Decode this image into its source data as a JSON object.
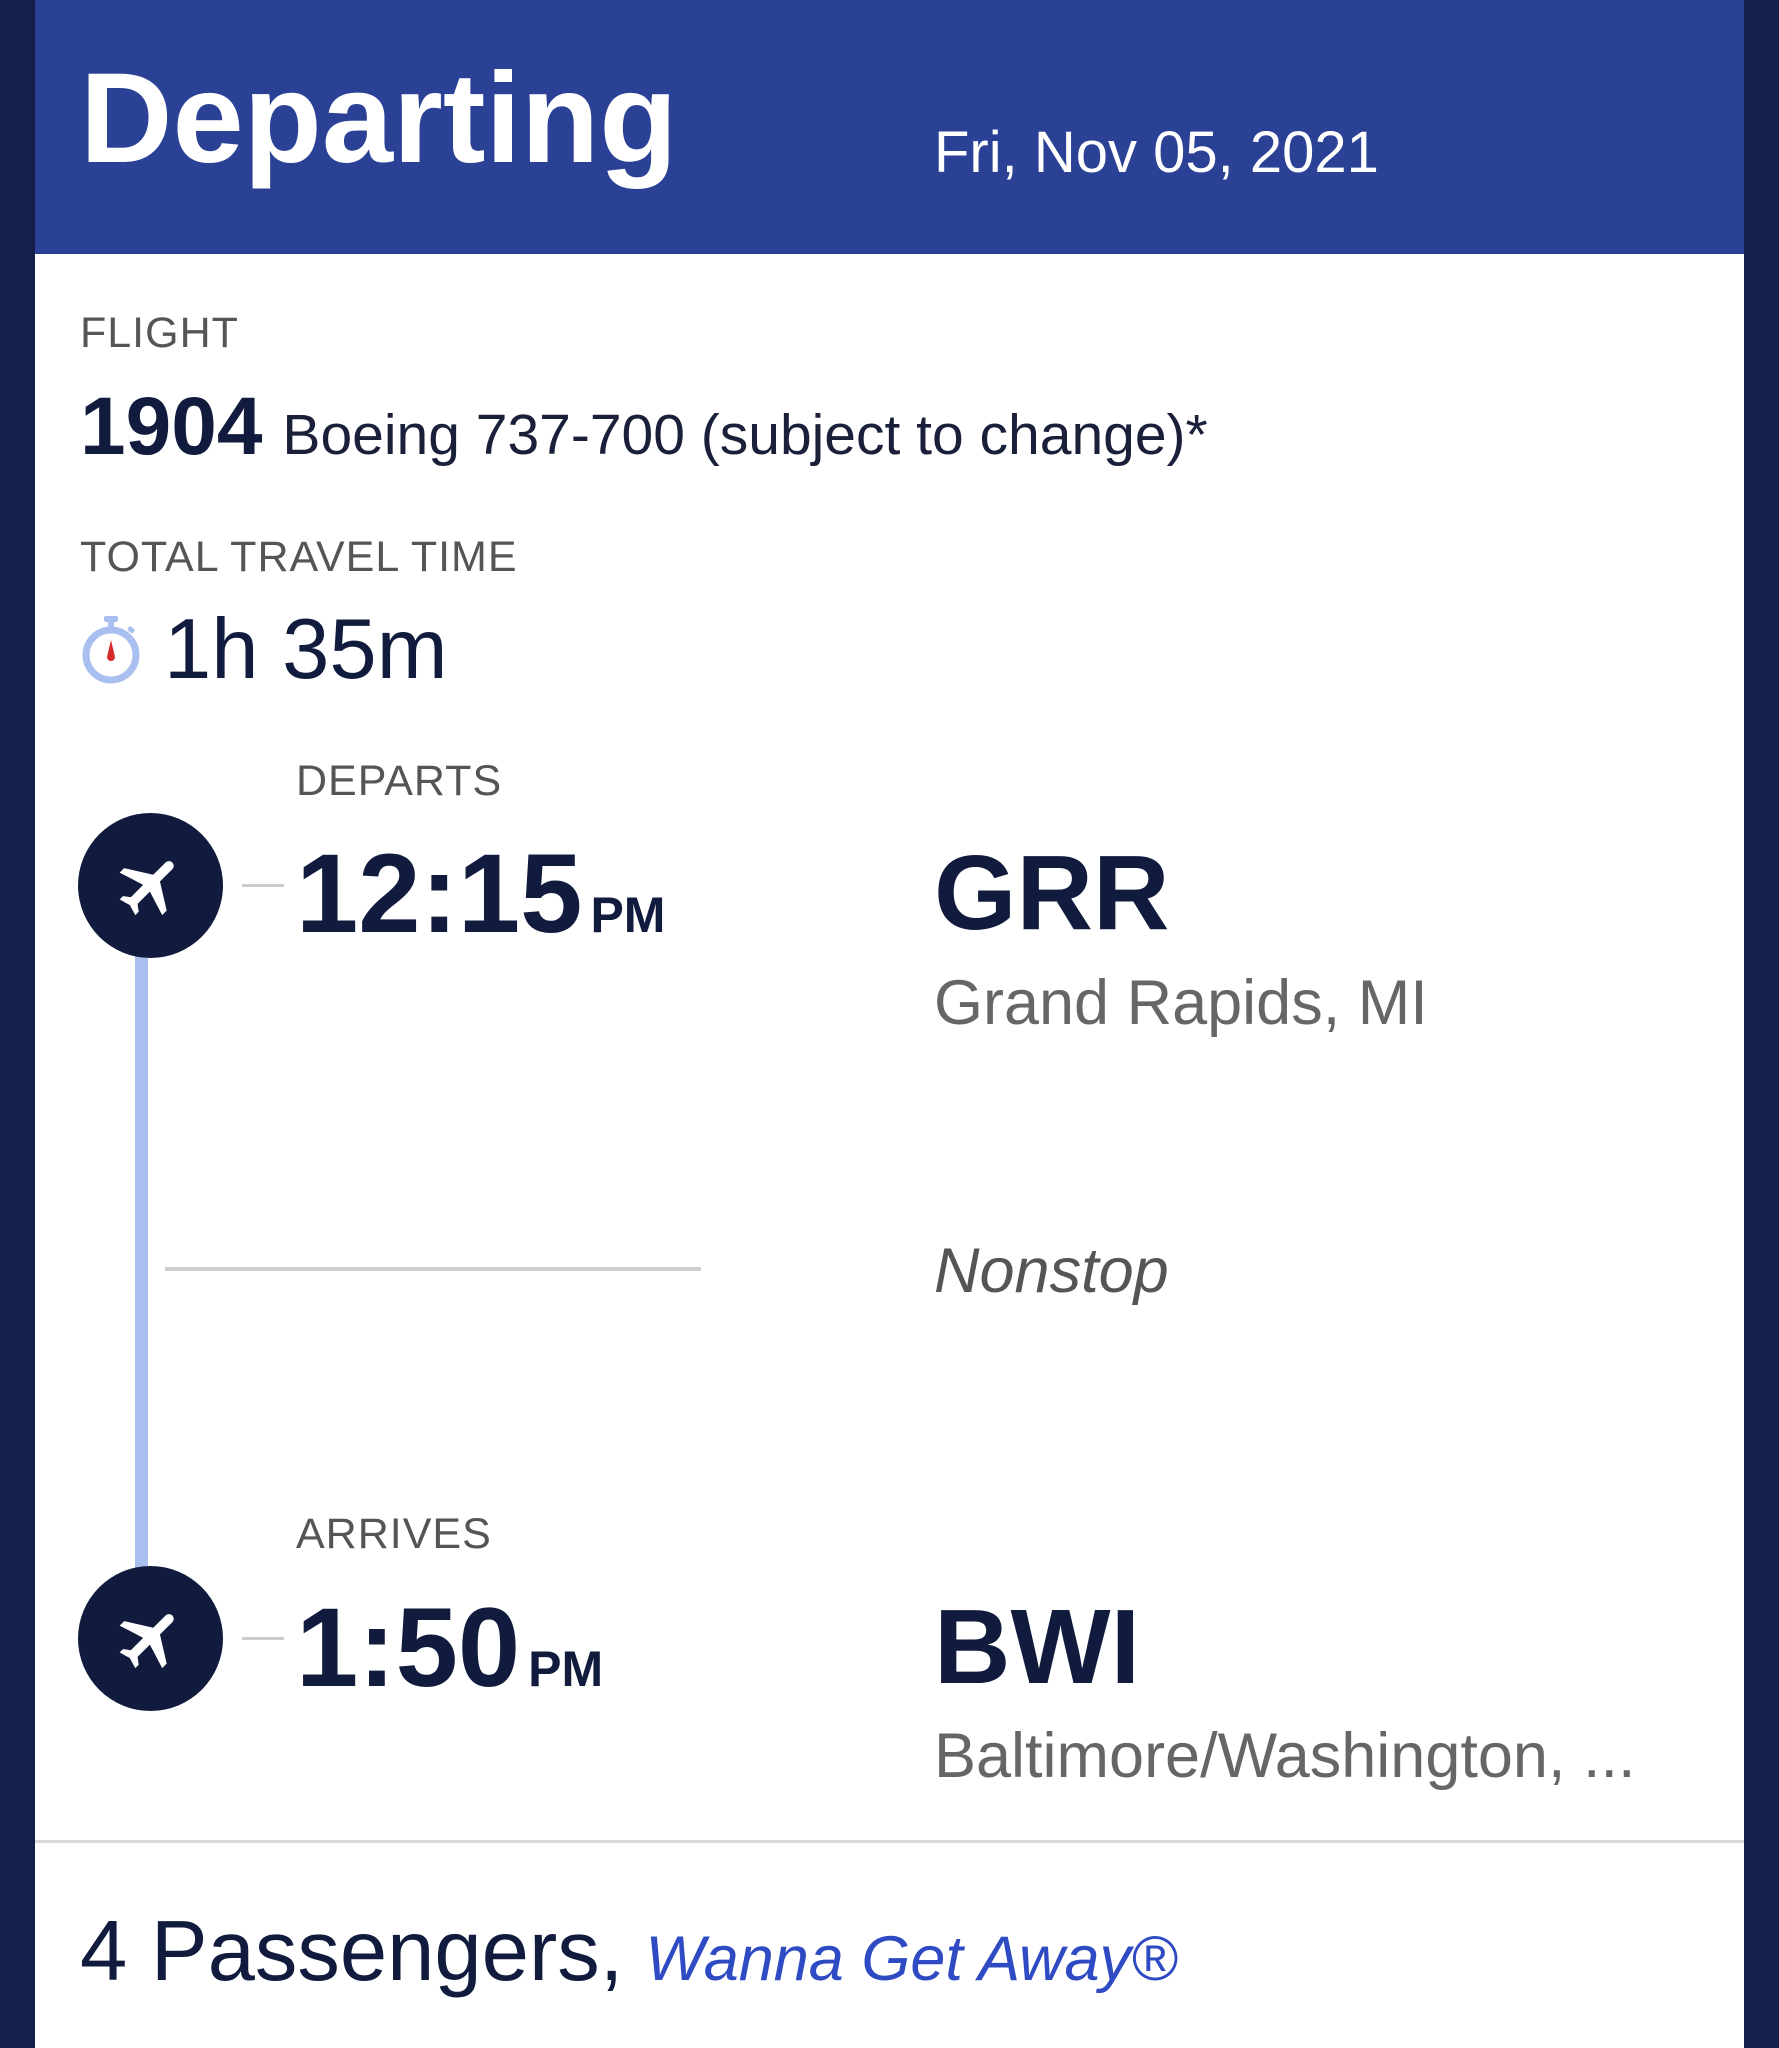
{
  "header": {
    "title": "Departing",
    "date": "Fri, Nov 05, 2021"
  },
  "flight": {
    "label": "FLIGHT",
    "number": "1904",
    "aircraft": "Boeing 737-700 (subject to change)*"
  },
  "travel_time": {
    "label": "TOTAL TRAVEL TIME",
    "duration": "1h 35m",
    "icon": "stopwatch-icon"
  },
  "departure": {
    "label": "DEPARTS",
    "time": "12:15",
    "ampm": "PM",
    "airport_code": "GRR",
    "city": "Grand Rapids, MI",
    "icon": "airplane-takeoff-icon"
  },
  "stops": {
    "label": "Nonstop"
  },
  "arrival": {
    "label": "ARRIVES",
    "time": "1:50",
    "ampm": "PM",
    "airport_code": "BWI",
    "city": "Baltimore/Washington, ...",
    "icon": "airplane-landing-icon"
  },
  "footer": {
    "passengers": "4 Passengers,",
    "fare_type": "Wanna Get Away®"
  },
  "colors": {
    "header_blue": "#2a4196",
    "navy": "#111b3d",
    "timeline": "#a9bff0",
    "link_blue": "#2f4bc3",
    "background": "#14204a"
  }
}
